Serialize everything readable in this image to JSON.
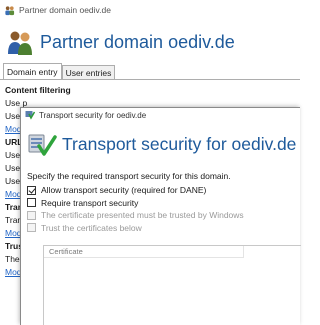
{
  "window": {
    "title": "Partner domain oediv.de",
    "header_title": "Partner domain oediv.de"
  },
  "tabs": [
    {
      "label": "Domain entry"
    },
    {
      "label": "User entries"
    }
  ],
  "background": {
    "content_filtering_heading": "Content filtering",
    "rows": [
      "Use p",
      "Use p",
      "Mod"
    ],
    "url_heading": "URL",
    "url_rows": [
      "Use p",
      "Use p",
      "Use p",
      "Mod"
    ],
    "trans_heading": "Trans",
    "trans_rows": [
      "Trans",
      "Mod"
    ],
    "trust_heading": "Trust",
    "trust_rows": [
      "The t",
      "Mod"
    ]
  },
  "dialog": {
    "window_title": "Transport security for oediv.de",
    "header_title": "Transport security for oediv.de",
    "description": "Specify the required transport security for this domain.",
    "options": [
      {
        "label": "Allow transport security (required for DANE)",
        "checked": true,
        "enabled": true
      },
      {
        "label": "Require transport security",
        "checked": false,
        "enabled": true
      },
      {
        "label": "The certificate presented must be trusted by Windows",
        "checked": false,
        "enabled": false
      },
      {
        "label": "Trust the certificates below",
        "checked": false,
        "enabled": false
      }
    ],
    "table": {
      "column_header": "Certificate"
    }
  },
  "colors": {
    "title_blue": "#1e5a9b",
    "link_blue": "#2366c6"
  }
}
